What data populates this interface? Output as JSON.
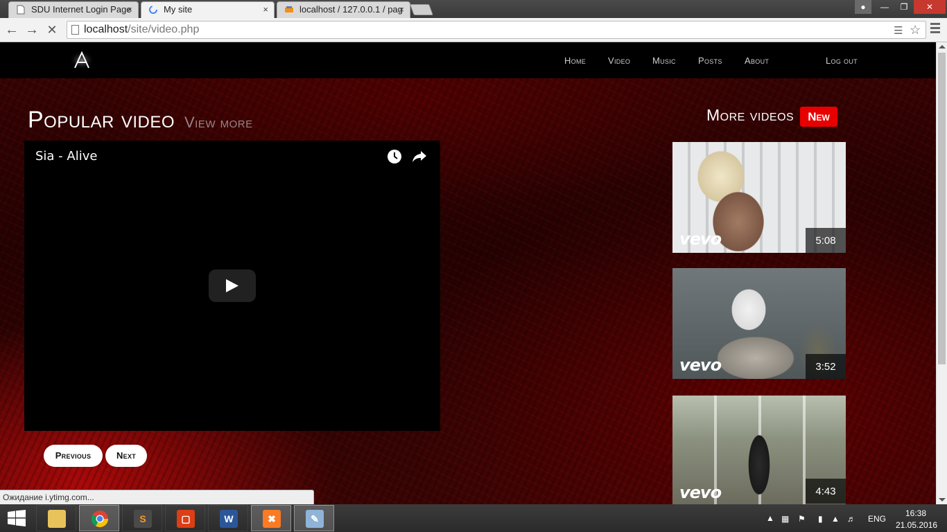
{
  "browser": {
    "tabs": [
      {
        "label": "SDU Internet Login Page",
        "close": "×"
      },
      {
        "label": "My site",
        "close": "×"
      },
      {
        "label": "localhost / 127.0.0.1 / pag",
        "close": "×"
      }
    ],
    "url": {
      "host": "localhost",
      "path": "/site/video.php"
    },
    "status_text": "Ожидание i.ytimg.com..."
  },
  "site": {
    "logo_letter": "A",
    "nav": [
      "Home",
      "Video",
      "Music",
      "Posts",
      "About"
    ],
    "logout": "Log out",
    "section_title": "Popular video",
    "view_more": "View more",
    "player": {
      "title": "Sia - Alive"
    },
    "pager": {
      "previous": "Previous",
      "next": "Next"
    },
    "sidebar": {
      "title": "More videos",
      "badge": "New",
      "videos": [
        {
          "brand": "vevo",
          "duration": "5:08"
        },
        {
          "brand": "vevo",
          "duration": "3:52"
        },
        {
          "brand": "vevo",
          "duration": "4:43"
        }
      ]
    },
    "colors": {
      "accent": "#e80000",
      "nav_bg": "#000000",
      "background": "#2a0303"
    }
  },
  "taskbar": {
    "apps": [
      "file-explorer",
      "chrome",
      "sublime-text",
      "office",
      "word",
      "xampp",
      "paint"
    ],
    "language": "ENG",
    "time": "16:38",
    "date": "21.05.2016"
  }
}
